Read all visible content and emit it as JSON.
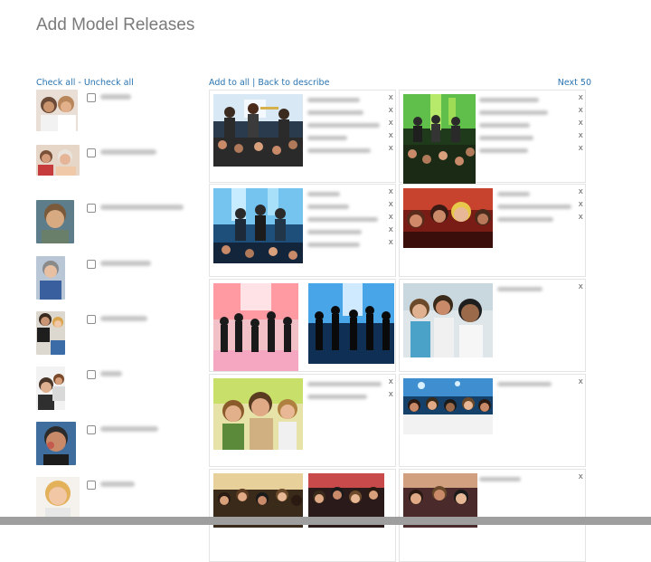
{
  "page": {
    "title": "Add Model Releases"
  },
  "links": {
    "check_all": "Check all",
    "dash": " - ",
    "uncheck_all": "Uncheck all",
    "add_to_all": "Add to all",
    "pipe": " | ",
    "back_to_describe": "Back to describe",
    "next": "Next 50"
  },
  "remove_symbol": "x",
  "colors": {
    "link": "#2a74b0",
    "title": "#7a7a7a",
    "cell_border": "#e4e4e4"
  },
  "people_count_shown": 8,
  "photos": [
    {
      "id": "concert-trumpet"
    },
    {
      "id": "concert-green-stage"
    },
    {
      "id": "band-blue-stage"
    },
    {
      "id": "friends-red-party"
    },
    {
      "id": "dance-silhouettes-pink"
    },
    {
      "id": "dance-silhouettes-blue"
    },
    {
      "id": "women-laughing"
    },
    {
      "id": "girls-party-yellow"
    },
    {
      "id": "friends-blue-lights"
    },
    {
      "id": "crowd-cheering-1"
    },
    {
      "id": "crowd-cheering-2"
    },
    {
      "id": "crowd-cheering-3"
    }
  ]
}
